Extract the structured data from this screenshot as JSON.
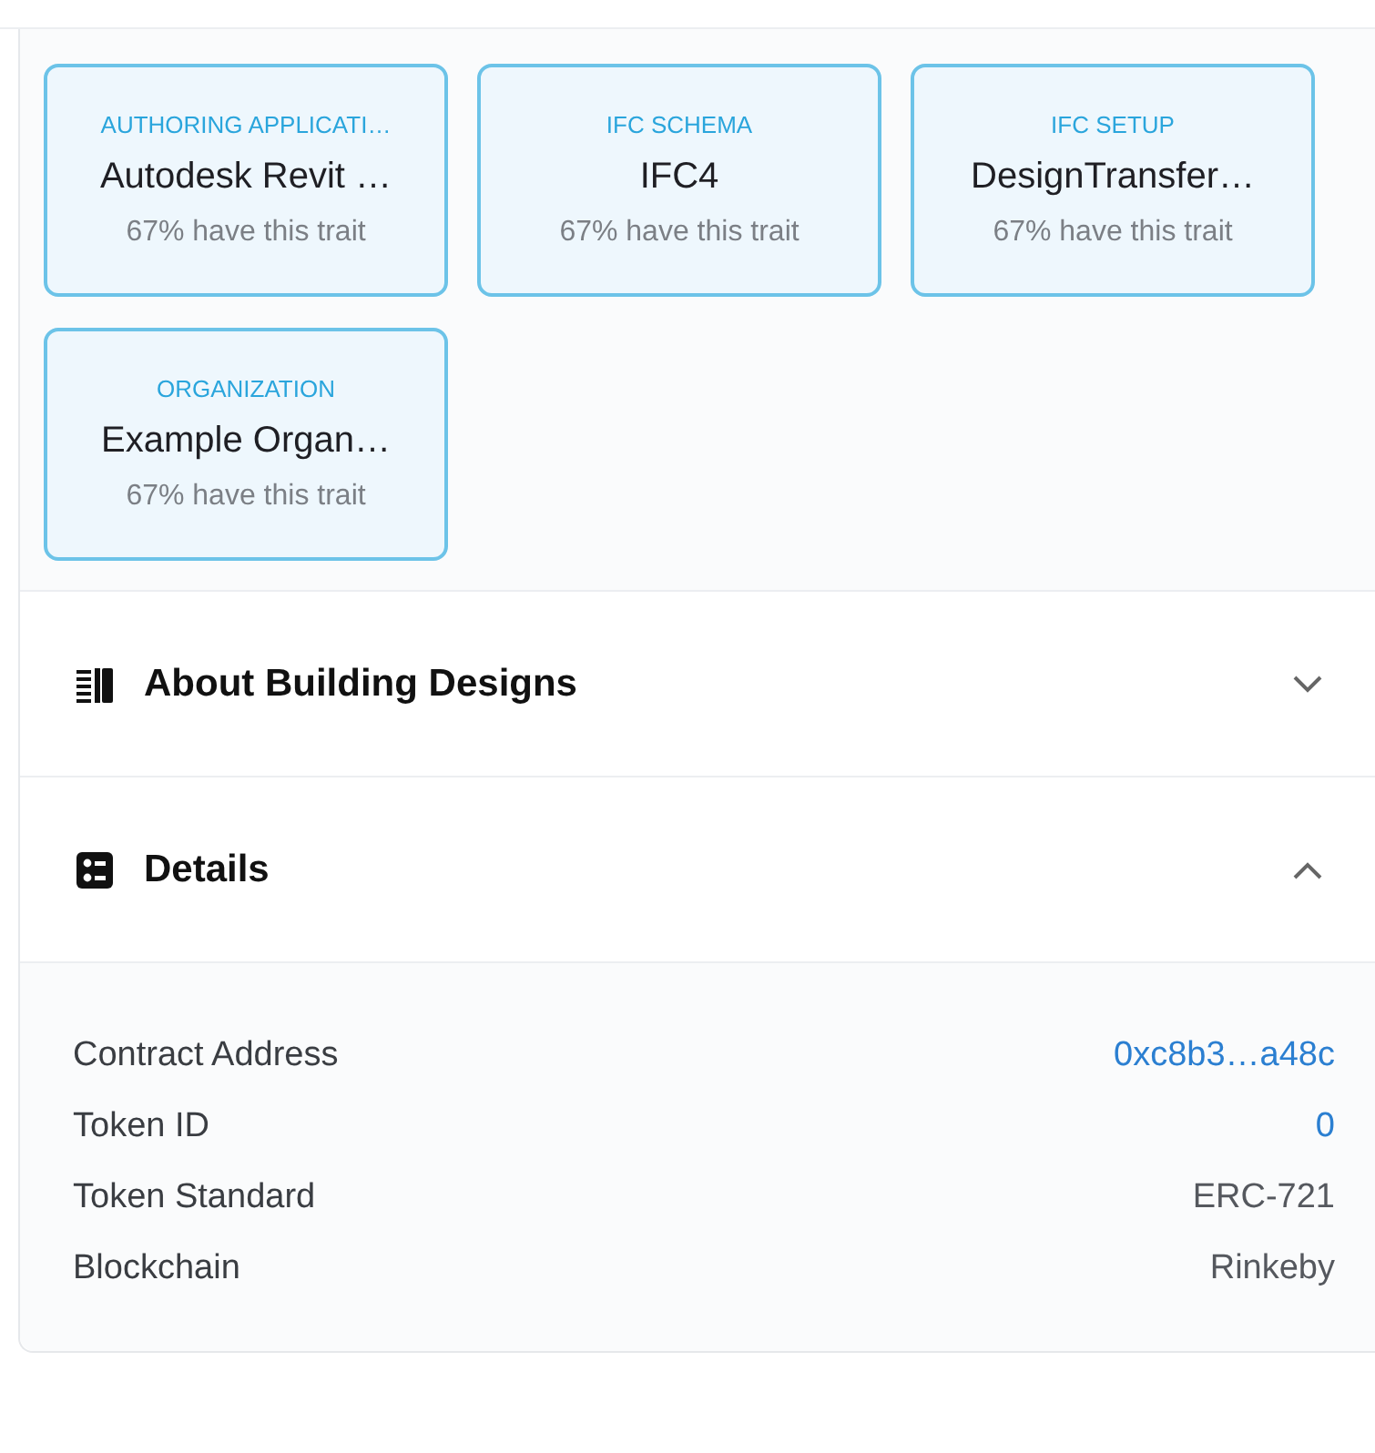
{
  "traits": [
    {
      "type": "AUTHORING APPLICATI…",
      "value": "Autodesk Revit …",
      "rarity": "67% have this trait"
    },
    {
      "type": "IFC SCHEMA",
      "value": "IFC4",
      "rarity": "67% have this trait"
    },
    {
      "type": "IFC SETUP",
      "value": "DesignTransfer…",
      "rarity": "67% have this trait"
    },
    {
      "type": "ORGANIZATION",
      "value": "Example Organ…",
      "rarity": "67% have this trait"
    }
  ],
  "sections": [
    {
      "title": "About Building Designs",
      "expanded": false
    },
    {
      "title": "Details",
      "expanded": true
    }
  ],
  "details": [
    {
      "label": "Contract Address",
      "value": "0xc8b3…a48c",
      "kind": "link"
    },
    {
      "label": "Token ID",
      "value": "0",
      "kind": "link"
    },
    {
      "label": "Token Standard",
      "value": "ERC-721",
      "kind": "text"
    },
    {
      "label": "Blockchain",
      "value": "Rinkeby",
      "kind": "text"
    }
  ]
}
